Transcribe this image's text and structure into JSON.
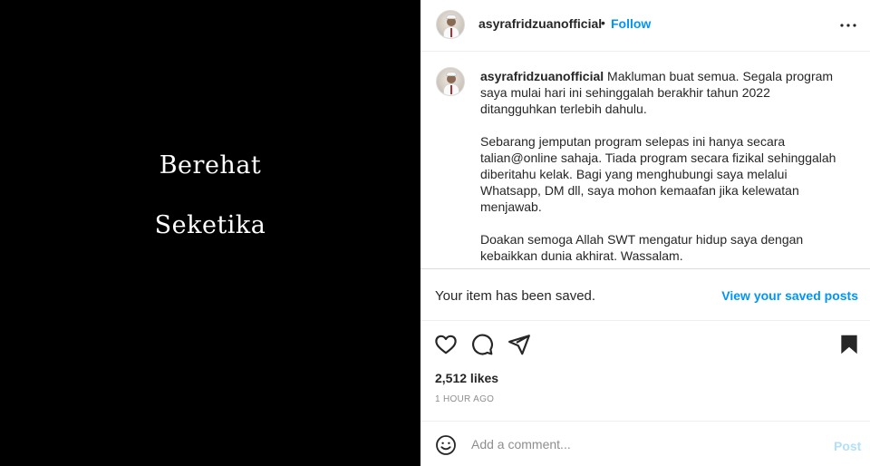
{
  "media": {
    "line1": "Berehat",
    "line2": "Seketika"
  },
  "header": {
    "username": "asyrafridzuanofficial",
    "separator": "•",
    "follow_label": "Follow",
    "more_icon": "more-horizontal-icon"
  },
  "caption": {
    "username": "asyrafridzuanofficial",
    "paragraphs": [
      "Makluman buat semua. Segala program saya mulai hari ini sehinggalah berakhir tahun 2022 ditangguhkan terlebih dahulu.",
      "Sebarang jemputan program selepas ini hanya secara talian@online sahaja. Tiada program secara fizikal sehinggalah diberitahu kelak. Bagi yang menghubungi saya melalui Whatsapp, DM dll, saya mohon kemaafan jika kelewatan menjawab.",
      "Doakan semoga Allah SWT mengatur hidup saya dengan kebaikkan dunia akhirat. Wassalam."
    ]
  },
  "saved_notice": {
    "text": "Your item has been saved.",
    "link": "View your saved posts"
  },
  "actions": {
    "icons": [
      "heart-icon",
      "comment-icon",
      "share-icon",
      "bookmark-filled-icon"
    ]
  },
  "likes": "2,512 likes",
  "time": "1 HOUR AGO",
  "comment": {
    "placeholder": "Add a comment...",
    "post_label": "Post"
  },
  "colors": {
    "accent": "#0095f6",
    "post_disabled": "#b2dffc",
    "media_bg": "#000000",
    "text": "#262626",
    "muted": "#8e8e8e"
  }
}
